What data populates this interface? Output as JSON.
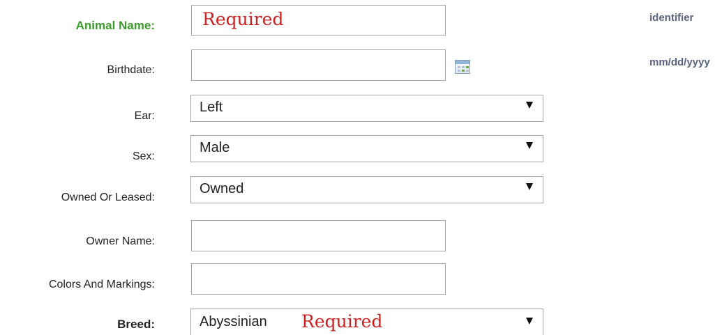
{
  "form": {
    "animal_name": {
      "label": "Animal Name:",
      "value": "",
      "placeholder_note": "Required",
      "hint": "identifier"
    },
    "birthdate": {
      "label": "Birthdate:",
      "value": "",
      "hint": "mm/dd/yyyy",
      "calendar_icon": "calendar-icon"
    },
    "ear": {
      "label": "Ear:",
      "selected": "Left"
    },
    "sex": {
      "label": "Sex:",
      "selected": "Male"
    },
    "owned_or_leased": {
      "label": "Owned Or Leased:",
      "selected": "Owned"
    },
    "owner_name": {
      "label": "Owner Name:",
      "value": ""
    },
    "colors_and_markings": {
      "label": "Colors And Markings:",
      "value": ""
    },
    "breed": {
      "label": "Breed:",
      "selected": "Abyssinian",
      "required_note": "Required"
    }
  },
  "colors": {
    "required_label": "#3a9b2a",
    "required_note": "#cc1f1f",
    "hint_text": "#5a6480"
  }
}
